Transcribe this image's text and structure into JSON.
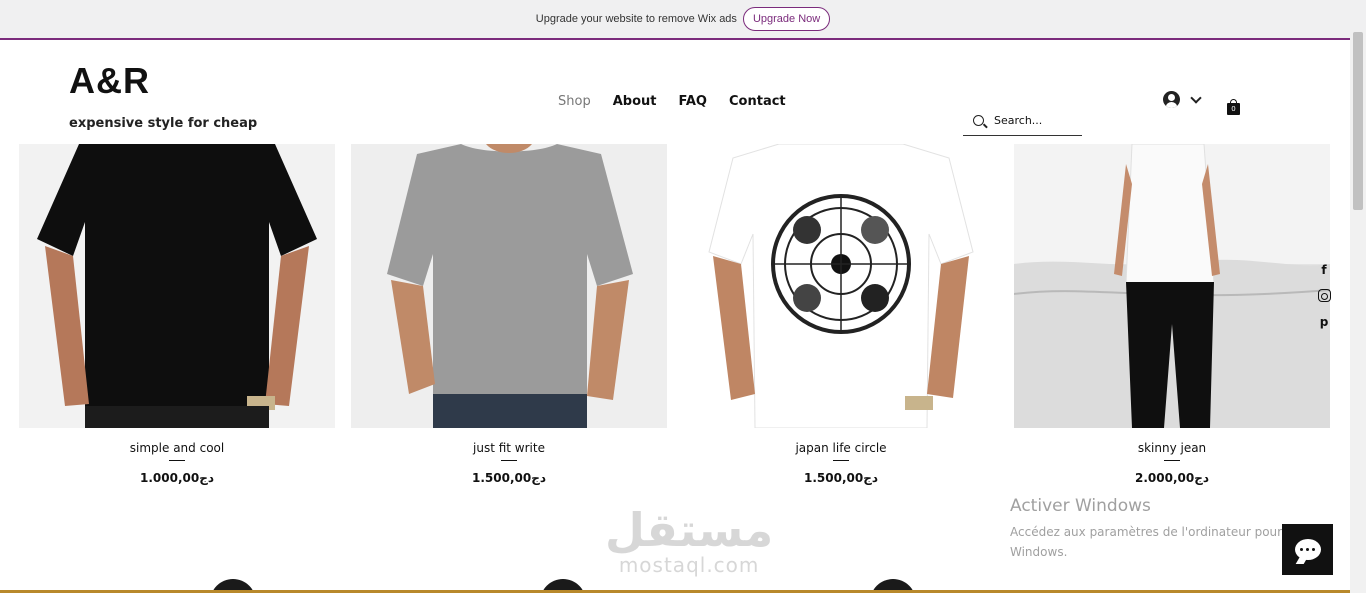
{
  "wix_banner": {
    "message": "Upgrade your website to remove Wix ads",
    "button": "Upgrade Now"
  },
  "header": {
    "logo": "A&R",
    "tagline": "expensive style for cheap",
    "nav": [
      {
        "label": "Shop",
        "active": true
      },
      {
        "label": "About",
        "active": false
      },
      {
        "label": "FAQ",
        "active": false
      },
      {
        "label": "Contact",
        "active": false
      }
    ],
    "search_placeholder": "Search...",
    "cart_count": "0"
  },
  "products": [
    {
      "name": "simple and cool",
      "price": "1.000,00دج",
      "shirt_color": "#0e0e0e",
      "bg": "#f2f2f2"
    },
    {
      "name": "just fit write",
      "price": "1.500,00دج",
      "shirt_color": "#9b9b9b",
      "bg": "#eeeeee"
    },
    {
      "name": "japan life circle",
      "price": "1.500,00دج",
      "shirt_color": "#ffffff",
      "bg": "#ffffff"
    },
    {
      "name": "skinny jean",
      "price": "2.000,00دج",
      "shirt_color": "#ffffff",
      "bg": "#dedede"
    }
  ],
  "windows_notice": {
    "title": "Activer Windows",
    "body": "Accédez aux paramètres de l'ordinateur pour activer Windows."
  },
  "watermark": {
    "arabic": "مستقل",
    "latin": "mostaql.com"
  },
  "colors": {
    "wix_accent": "#7b2b7c",
    "text": "#111111",
    "muted_nav": "#777777",
    "gold_line": "#b8892b"
  }
}
